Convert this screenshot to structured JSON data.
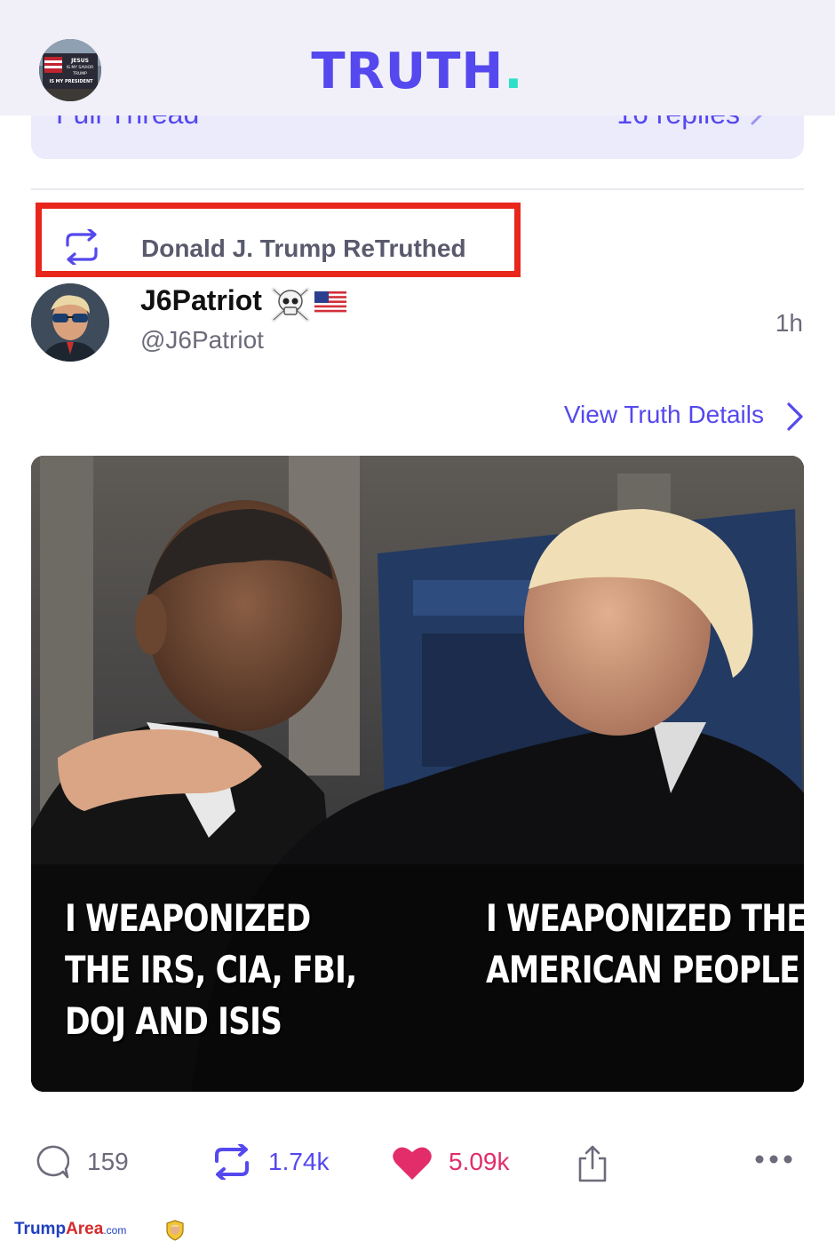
{
  "header": {
    "logo_text": "TRUTH",
    "logo_dot": ".",
    "avatar_icon": "profile-avatar",
    "avatar_caption": [
      "JESUS",
      "IS MY SAVIOR",
      "TRUMP",
      "IS MY PRESIDENT"
    ]
  },
  "thread": {
    "label": "Full Thread",
    "replies": "16 replies"
  },
  "retruth": {
    "text": "Donald J. Trump ReTruthed",
    "icon": "retruth-icon"
  },
  "post": {
    "author_name": "J6Patriot",
    "author_emojis": [
      "skull-crossbones",
      "us-flag"
    ],
    "handle": "@J6Patriot",
    "time": "1h",
    "view_details": "View Truth Details"
  },
  "media": {
    "caption_left": [
      "I WEAPONIZED",
      "THE IRS, CIA, FBI,",
      "DOJ AND ISIS"
    ],
    "caption_right": [
      "I WEAPONIZED THE",
      "AMERICAN PEOPLE"
    ]
  },
  "actions": {
    "replies": "159",
    "retruths": "1.74k",
    "likes": "5.09k",
    "icons": [
      "reply-icon",
      "retruth-icon",
      "heart-icon",
      "share-icon",
      "more-icon"
    ]
  },
  "watermark": {
    "part1": "Trump",
    "part2": "Area",
    "part3": ".com"
  },
  "colors": {
    "brand": "#5448ee",
    "accent": "#2ee0c8",
    "like": "#e22d6a",
    "highlight_box": "#e8261c"
  }
}
